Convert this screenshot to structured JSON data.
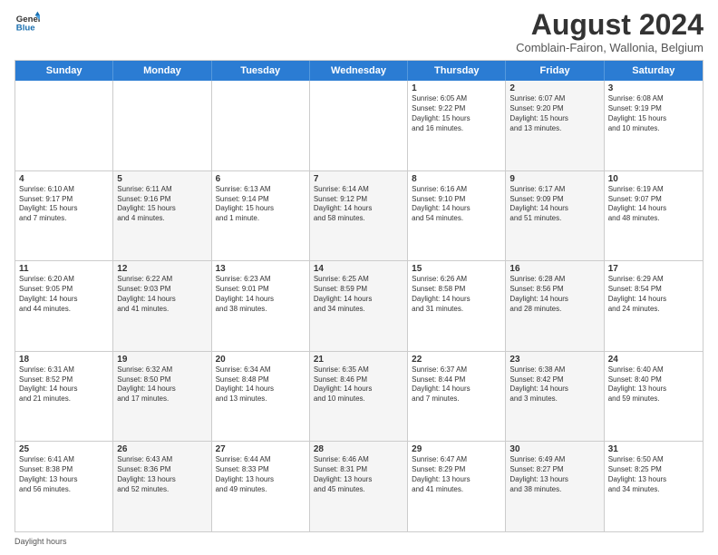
{
  "header": {
    "logo_line1": "General",
    "logo_line2": "Blue",
    "month_title": "August 2024",
    "subtitle": "Comblain-Fairon, Wallonia, Belgium"
  },
  "calendar": {
    "days": [
      "Sunday",
      "Monday",
      "Tuesday",
      "Wednesday",
      "Thursday",
      "Friday",
      "Saturday"
    ],
    "rows": [
      [
        {
          "day": "",
          "text": "",
          "alt": false
        },
        {
          "day": "",
          "text": "",
          "alt": false
        },
        {
          "day": "",
          "text": "",
          "alt": false
        },
        {
          "day": "",
          "text": "",
          "alt": false
        },
        {
          "day": "1",
          "text": "Sunrise: 6:05 AM\nSunset: 9:22 PM\nDaylight: 15 hours\nand 16 minutes.",
          "alt": false
        },
        {
          "day": "2",
          "text": "Sunrise: 6:07 AM\nSunset: 9:20 PM\nDaylight: 15 hours\nand 13 minutes.",
          "alt": true
        },
        {
          "day": "3",
          "text": "Sunrise: 6:08 AM\nSunset: 9:19 PM\nDaylight: 15 hours\nand 10 minutes.",
          "alt": false
        }
      ],
      [
        {
          "day": "4",
          "text": "Sunrise: 6:10 AM\nSunset: 9:17 PM\nDaylight: 15 hours\nand 7 minutes.",
          "alt": false
        },
        {
          "day": "5",
          "text": "Sunrise: 6:11 AM\nSunset: 9:16 PM\nDaylight: 15 hours\nand 4 minutes.",
          "alt": true
        },
        {
          "day": "6",
          "text": "Sunrise: 6:13 AM\nSunset: 9:14 PM\nDaylight: 15 hours\nand 1 minute.",
          "alt": false
        },
        {
          "day": "7",
          "text": "Sunrise: 6:14 AM\nSunset: 9:12 PM\nDaylight: 14 hours\nand 58 minutes.",
          "alt": true
        },
        {
          "day": "8",
          "text": "Sunrise: 6:16 AM\nSunset: 9:10 PM\nDaylight: 14 hours\nand 54 minutes.",
          "alt": false
        },
        {
          "day": "9",
          "text": "Sunrise: 6:17 AM\nSunset: 9:09 PM\nDaylight: 14 hours\nand 51 minutes.",
          "alt": true
        },
        {
          "day": "10",
          "text": "Sunrise: 6:19 AM\nSunset: 9:07 PM\nDaylight: 14 hours\nand 48 minutes.",
          "alt": false
        }
      ],
      [
        {
          "day": "11",
          "text": "Sunrise: 6:20 AM\nSunset: 9:05 PM\nDaylight: 14 hours\nand 44 minutes.",
          "alt": false
        },
        {
          "day": "12",
          "text": "Sunrise: 6:22 AM\nSunset: 9:03 PM\nDaylight: 14 hours\nand 41 minutes.",
          "alt": true
        },
        {
          "day": "13",
          "text": "Sunrise: 6:23 AM\nSunset: 9:01 PM\nDaylight: 14 hours\nand 38 minutes.",
          "alt": false
        },
        {
          "day": "14",
          "text": "Sunrise: 6:25 AM\nSunset: 8:59 PM\nDaylight: 14 hours\nand 34 minutes.",
          "alt": true
        },
        {
          "day": "15",
          "text": "Sunrise: 6:26 AM\nSunset: 8:58 PM\nDaylight: 14 hours\nand 31 minutes.",
          "alt": false
        },
        {
          "day": "16",
          "text": "Sunrise: 6:28 AM\nSunset: 8:56 PM\nDaylight: 14 hours\nand 28 minutes.",
          "alt": true
        },
        {
          "day": "17",
          "text": "Sunrise: 6:29 AM\nSunset: 8:54 PM\nDaylight: 14 hours\nand 24 minutes.",
          "alt": false
        }
      ],
      [
        {
          "day": "18",
          "text": "Sunrise: 6:31 AM\nSunset: 8:52 PM\nDaylight: 14 hours\nand 21 minutes.",
          "alt": false
        },
        {
          "day": "19",
          "text": "Sunrise: 6:32 AM\nSunset: 8:50 PM\nDaylight: 14 hours\nand 17 minutes.",
          "alt": true
        },
        {
          "day": "20",
          "text": "Sunrise: 6:34 AM\nSunset: 8:48 PM\nDaylight: 14 hours\nand 13 minutes.",
          "alt": false
        },
        {
          "day": "21",
          "text": "Sunrise: 6:35 AM\nSunset: 8:46 PM\nDaylight: 14 hours\nand 10 minutes.",
          "alt": true
        },
        {
          "day": "22",
          "text": "Sunrise: 6:37 AM\nSunset: 8:44 PM\nDaylight: 14 hours\nand 7 minutes.",
          "alt": false
        },
        {
          "day": "23",
          "text": "Sunrise: 6:38 AM\nSunset: 8:42 PM\nDaylight: 14 hours\nand 3 minutes.",
          "alt": true
        },
        {
          "day": "24",
          "text": "Sunrise: 6:40 AM\nSunset: 8:40 PM\nDaylight: 13 hours\nand 59 minutes.",
          "alt": false
        }
      ],
      [
        {
          "day": "25",
          "text": "Sunrise: 6:41 AM\nSunset: 8:38 PM\nDaylight: 13 hours\nand 56 minutes.",
          "alt": false
        },
        {
          "day": "26",
          "text": "Sunrise: 6:43 AM\nSunset: 8:36 PM\nDaylight: 13 hours\nand 52 minutes.",
          "alt": true
        },
        {
          "day": "27",
          "text": "Sunrise: 6:44 AM\nSunset: 8:33 PM\nDaylight: 13 hours\nand 49 minutes.",
          "alt": false
        },
        {
          "day": "28",
          "text": "Sunrise: 6:46 AM\nSunset: 8:31 PM\nDaylight: 13 hours\nand 45 minutes.",
          "alt": true
        },
        {
          "day": "29",
          "text": "Sunrise: 6:47 AM\nSunset: 8:29 PM\nDaylight: 13 hours\nand 41 minutes.",
          "alt": false
        },
        {
          "day": "30",
          "text": "Sunrise: 6:49 AM\nSunset: 8:27 PM\nDaylight: 13 hours\nand 38 minutes.",
          "alt": true
        },
        {
          "day": "31",
          "text": "Sunrise: 6:50 AM\nSunset: 8:25 PM\nDaylight: 13 hours\nand 34 minutes.",
          "alt": false
        }
      ]
    ]
  },
  "footer": {
    "label": "Daylight hours"
  }
}
